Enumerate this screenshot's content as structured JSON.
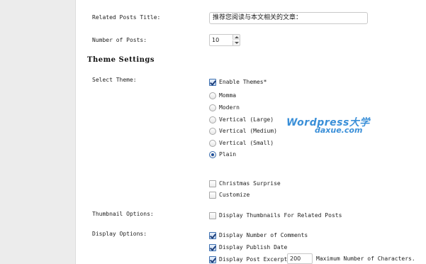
{
  "related_posts_title": {
    "label": "Related Posts Title:",
    "value": "推荐您阅读与本文相关的文章："
  },
  "number_of_posts": {
    "label": "Number of Posts:",
    "value": "10"
  },
  "theme_settings": {
    "heading": "Theme Settings",
    "select_theme_label": "Select Theme:",
    "enable_themes": {
      "label": "Enable Themes*",
      "checked": true
    },
    "themes": [
      {
        "label": "Momma",
        "selected": false
      },
      {
        "label": "Modern",
        "selected": false
      },
      {
        "label": "Vertical (Large)",
        "selected": false
      },
      {
        "label": "Vertical (Medium)",
        "selected": false
      },
      {
        "label": "Vertical (Small)",
        "selected": false
      },
      {
        "label": "Plain",
        "selected": true
      }
    ],
    "extras": [
      {
        "label": "Christmas Surprise",
        "checked": false
      },
      {
        "label": "Customize",
        "checked": false
      }
    ]
  },
  "thumbnail_options": {
    "label": "Thumbnail Options:",
    "display_thumbnails": {
      "label": "Display Thumbnails For Related Posts",
      "checked": false
    }
  },
  "display_options": {
    "label": "Display Options:",
    "items": [
      {
        "label": "Display Number of Comments",
        "checked": true
      },
      {
        "label": "Display Publish Date",
        "checked": true
      },
      {
        "label": "Display Post Excerpt",
        "checked": true
      }
    ],
    "excerpt_length": "200",
    "excerpt_suffix": "Maximum Number of Characters."
  },
  "watermark": {
    "line1": "Wordpress大学",
    "line2": "daxue.com"
  },
  "colors": {
    "gutter": "#ececec",
    "checkbox_checked": "#3c6fb0",
    "watermark": "#3a8fd8"
  }
}
